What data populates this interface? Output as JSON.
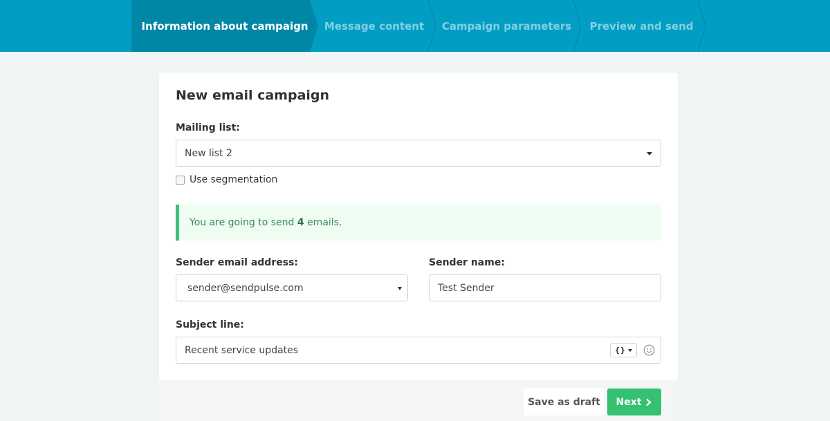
{
  "steps": [
    {
      "label": "Information about campaign",
      "active": true
    },
    {
      "label": "Message content",
      "active": false
    },
    {
      "label": "Campaign parameters",
      "active": false
    },
    {
      "label": "Preview and send",
      "active": false
    }
  ],
  "form": {
    "title": "New email campaign",
    "mailing_list_label": "Mailing list:",
    "mailing_list_value": "New list 2",
    "segmentation_label": "Use segmentation",
    "alert": {
      "prefix": "You are going to send",
      "count": "4",
      "suffix": "emails."
    },
    "sender_email_label": "Sender email address:",
    "sender_email_value": "sender@sendpulse.com",
    "sender_name_label": "Sender name:",
    "sender_name_value": "Test Sender",
    "subject_label": "Subject line:",
    "subject_value": "Recent service updates",
    "variables_button": "{}"
  },
  "footer": {
    "save_draft": "Save as draft",
    "next": "Next"
  },
  "colors": {
    "header_bg": "#029dc2",
    "active_step_bg": "#0187a6",
    "next_button": "#34c172",
    "alert_border": "#3ebf78"
  },
  "icons": {
    "dropdown": "caret-down-icon",
    "emoji": "smiley-icon",
    "next": "chevron-right-icon"
  }
}
